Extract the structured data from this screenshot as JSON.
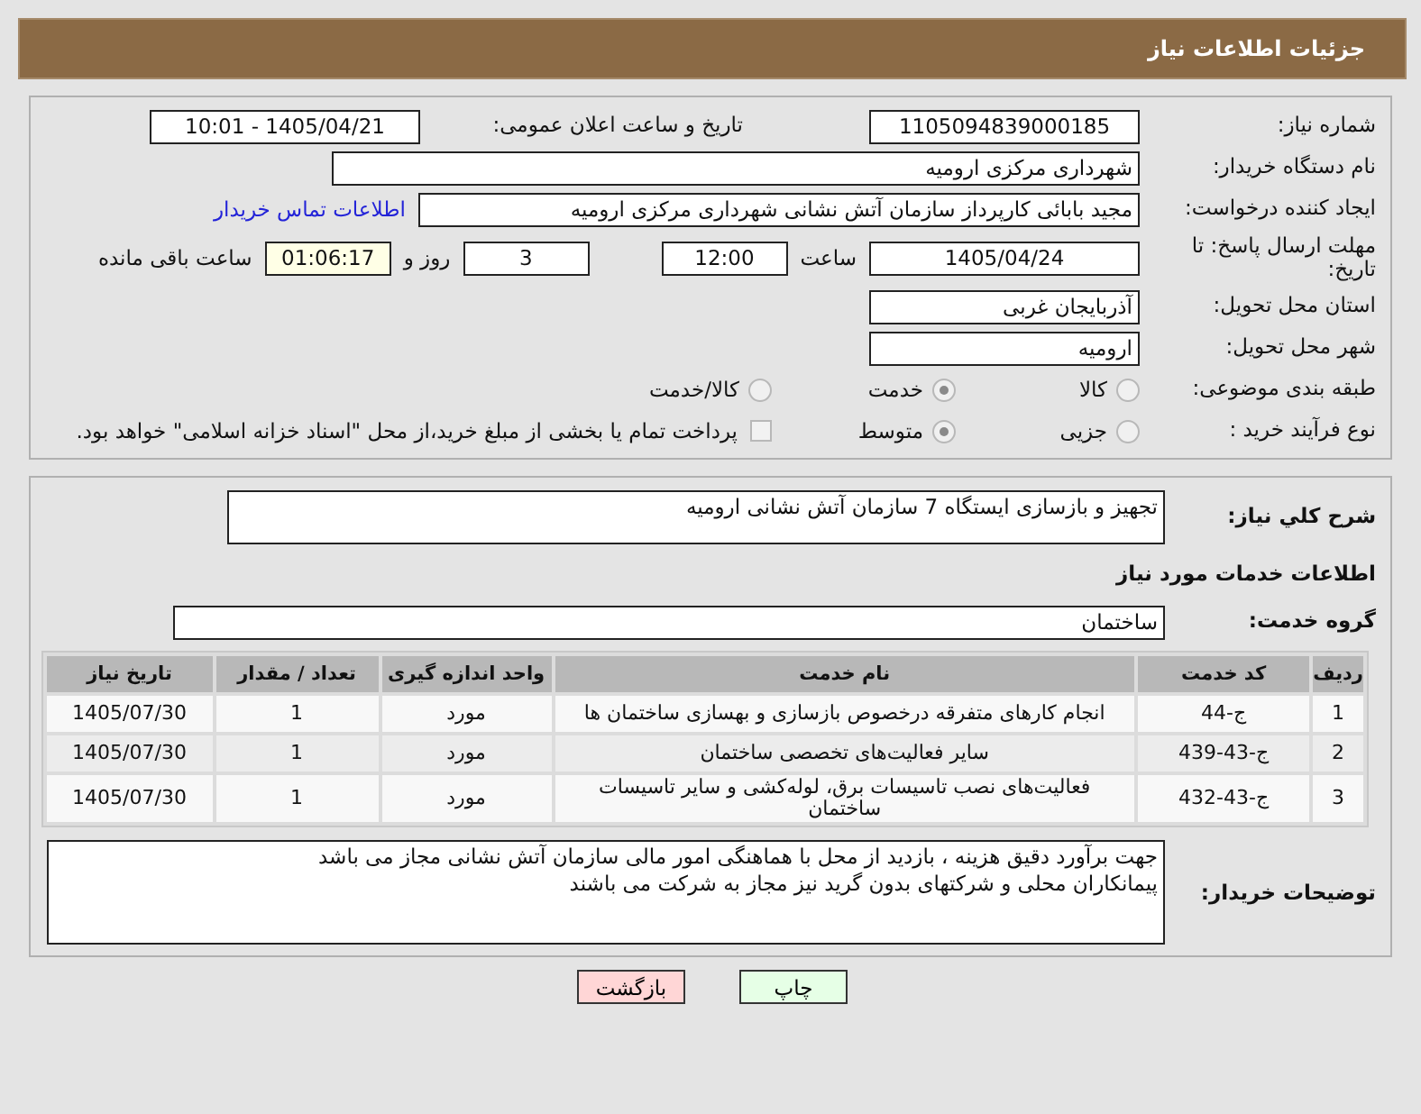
{
  "header": {
    "title": "جزئیات اطلاعات نیاز"
  },
  "need_number": {
    "label": "شماره نیاز:",
    "value": "1105094839000185"
  },
  "announce": {
    "label": "تاریخ و ساعت اعلان عمومی:",
    "value": "1405/04/21 - 10:01"
  },
  "buyer": {
    "label": "نام دستگاه خریدار:",
    "value": "شهرداری مرکزی ارومیه"
  },
  "creator": {
    "label": "ایجاد کننده درخواست:",
    "value": "مجید بابائی کارپرداز سازمان آتش نشانی شهرداری مرکزی ارومیه",
    "link": "اطلاعات تماس خریدار"
  },
  "deadline": {
    "label": "مهلت ارسال پاسخ: تا تاریخ:",
    "date": "1405/04/24",
    "time_label": "ساعت",
    "time": "12:00",
    "days": "3",
    "days_label": "روز و",
    "remaining": "01:06:17",
    "remaining_label": "ساعت باقی مانده"
  },
  "province": {
    "label": "استان محل تحویل:",
    "value": "آذربایجان غربی"
  },
  "city": {
    "label": "شهر محل تحویل:",
    "value": "ارومیه"
  },
  "category": {
    "label": "طبقه بندی موضوعی:",
    "options": [
      {
        "label": "کالا",
        "selected": false
      },
      {
        "label": "خدمت",
        "selected": true
      },
      {
        "label": "کالا/خدمت",
        "selected": false
      }
    ]
  },
  "process": {
    "label": "نوع فرآیند خرید :",
    "options": [
      {
        "label": "جزیی",
        "selected": false
      },
      {
        "label": "متوسط",
        "selected": true
      }
    ],
    "payment": {
      "checked": false,
      "text": "پرداخت تمام یا بخشی از مبلغ خرید،از محل \"اسناد خزانه اسلامی\" خواهد بود."
    }
  },
  "description": {
    "label": "شرح کلي نياز:",
    "value": "تجهیز و بازسازی ایستگاه 7 سازمان آتش نشانی ارومیه"
  },
  "services_heading": "اطلاعات خدمات مورد نیاز",
  "service_group": {
    "label": "گروه خدمت:",
    "value": "ساختمان"
  },
  "table": {
    "columns": [
      "ردیف",
      "کد خدمت",
      "نام خدمت",
      "واحد اندازه گیری",
      "تعداد / مقدار",
      "تاریخ نیاز"
    ],
    "rows": [
      [
        "1",
        "ج-44",
        "انجام کارهای متفرقه درخصوص بازسازی و بهسازی ساختمان ها",
        "مورد",
        "1",
        "1405/07/30"
      ],
      [
        "2",
        "ج-43-439",
        "سایر فعالیت‌های تخصصی ساختمان",
        "مورد",
        "1",
        "1405/07/30"
      ],
      [
        "3",
        "ج-43-432",
        "فعالیت‌های نصب تاسیسات برق، لوله‌کشی و سایر تاسیسات ساختمان",
        "مورد",
        "1",
        "1405/07/30"
      ]
    ]
  },
  "buyer_notes": {
    "label": "توضیحات خریدار:",
    "lines": [
      "جهت برآورد دقیق هزینه ، بازدید از محل با هماهنگی امور مالی سازمان آتش نشانی مجاز می باشد",
      "پیمانکاران محلی و شرکتهای بدون گرید نیز مجاز به شرکت می باشند"
    ]
  },
  "buttons": [
    {
      "label": "چاپ",
      "kind": "print"
    },
    {
      "label": "بازگشت",
      "kind": "back"
    }
  ]
}
